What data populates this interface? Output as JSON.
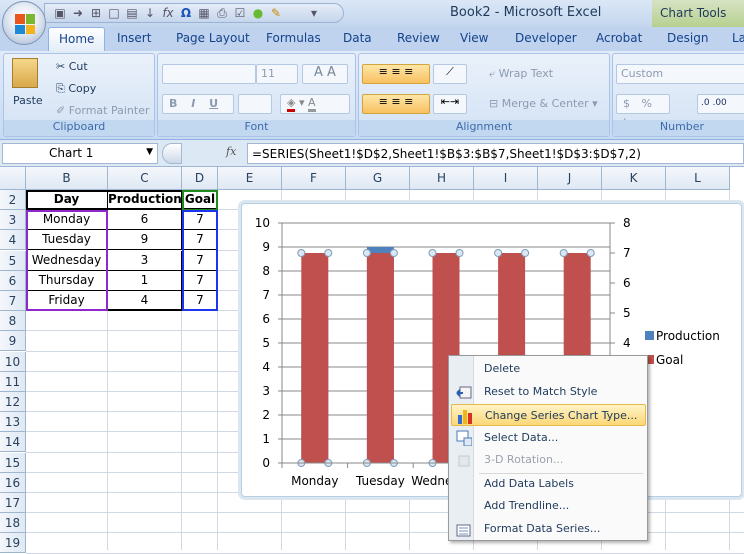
{
  "app": {
    "title": "Book2 - Microsoft Excel",
    "context_tab": "Chart Tools"
  },
  "tabs": [
    "Home",
    "Insert",
    "Page Layout",
    "Formulas",
    "Data",
    "Review",
    "View",
    "Developer",
    "Acrobat",
    "Design",
    "La"
  ],
  "ribbon": {
    "clipboard": {
      "label": "Clipboard",
      "paste": "Paste",
      "cut": "Cut",
      "copy": "Copy",
      "format_painter": "Format Painter"
    },
    "font": {
      "label": "Font",
      "size": "11",
      "bold": "B",
      "italic": "I",
      "underline": "U"
    },
    "alignment": {
      "label": "Alignment",
      "wrap_text": "Wrap Text",
      "merge_center": "Merge & Center"
    },
    "number": {
      "label": "Number",
      "format": "Custom",
      "currency": "$",
      "percent": "%",
      "comma": ",",
      "inc_decimal": ".00",
      "dec_decimal": ".0"
    }
  },
  "formula_bar": {
    "name_box": "Chart 1",
    "fx": "fx",
    "formula": "=SERIES(Sheet1!$D$2,Sheet1!$B$3:$B$7,Sheet1!$D$3:$D$7,2)"
  },
  "sheet": {
    "columns": [
      "B",
      "C",
      "D",
      "E",
      "F",
      "G",
      "H",
      "I",
      "J",
      "K",
      "L"
    ],
    "rows": [
      "2",
      "3",
      "4",
      "5",
      "6",
      "7",
      "8",
      "9",
      "10",
      "11",
      "12",
      "13",
      "14",
      "15",
      "16",
      "17",
      "18",
      "19"
    ],
    "table": {
      "headers": [
        "Day",
        "Production",
        "Goal"
      ],
      "rows": [
        [
          "Monday",
          "6",
          "7"
        ],
        [
          "Tuesday",
          "9",
          "7"
        ],
        [
          "Wednesday",
          "3",
          "7"
        ],
        [
          "Thursday",
          "1",
          "7"
        ],
        [
          "Friday",
          "4",
          "7"
        ]
      ]
    }
  },
  "chart_data": {
    "type": "bar",
    "categories": [
      "Monday",
      "Tuesday",
      "Wednesday",
      "Thursday",
      "Friday"
    ],
    "series": [
      {
        "name": "Production",
        "axis": "primary",
        "values": [
          6,
          9,
          3,
          1,
          4
        ],
        "color": "#4f81bd"
      },
      {
        "name": "Goal",
        "axis": "secondary",
        "values": [
          7,
          7,
          7,
          7,
          7
        ],
        "color": "#c0504d"
      }
    ],
    "y_primary": {
      "range": [
        0,
        10
      ],
      "ticks": [
        "0",
        "1",
        "2",
        "3",
        "4",
        "5",
        "6",
        "7",
        "8",
        "9",
        "10"
      ]
    },
    "y_secondary": {
      "range": [
        0,
        8
      ],
      "ticks": [
        "0",
        "1",
        "2",
        "3",
        "4",
        "5",
        "6",
        "7",
        "8"
      ]
    },
    "legend": "right",
    "grid": true,
    "selected_series": "Goal"
  },
  "context_menu": {
    "items": [
      {
        "label": "Delete",
        "icon": "none"
      },
      {
        "label": "Reset to Match Style",
        "icon": "reset-style-icon"
      },
      {
        "label": "Change Series Chart Type...",
        "icon": "chart-type-icon",
        "highlighted": true
      },
      {
        "label": "Select Data...",
        "icon": "select-data-icon"
      },
      {
        "label": "3-D Rotation...",
        "icon": "3d-rotation-icon",
        "disabled": true
      },
      {
        "label": "Add Data Labels",
        "icon": "none"
      },
      {
        "label": "Add Trendline...",
        "icon": "none"
      },
      {
        "label": "Format Data Series...",
        "icon": "format-series-icon"
      }
    ]
  }
}
